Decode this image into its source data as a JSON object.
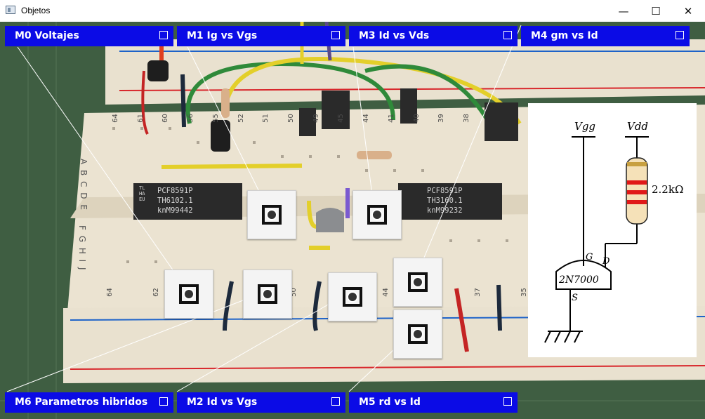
{
  "window": {
    "title": "Objetos",
    "controls": {
      "minimize": "—",
      "maximize": "☐",
      "close": "✕"
    }
  },
  "menus": {
    "top": [
      {
        "id": "M0",
        "label": "M0  Voltajes"
      },
      {
        "id": "M1",
        "label": "M1  Ig vs Vgs"
      },
      {
        "id": "M3",
        "label": "M3  Id vs Vds"
      },
      {
        "id": "M4",
        "label": "M4  gm vs Id"
      }
    ],
    "bottom": [
      {
        "id": "M6",
        "label": "M6  Parametros hibridos"
      },
      {
        "id": "M2",
        "label": "M2  Id vs Vgs"
      },
      {
        "id": "M5",
        "label": "M5  rd vs Id"
      }
    ]
  },
  "breadboard": {
    "row_letters_top": "A B C D E",
    "row_letters_bottom": "F G H I J",
    "column_numbers_top": [
      "64",
      "61",
      "60",
      "56",
      "55",
      "52",
      "51",
      "50",
      "49",
      "45",
      "44",
      "41",
      "40",
      "39",
      "38"
    ],
    "column_numbers_bottom": [
      "64",
      "62",
      "61",
      "56",
      "50",
      "45",
      "44",
      "40",
      "37",
      "35"
    ],
    "chips": [
      {
        "line1": "PCF8591P",
        "line2": "TH6102.1",
        "line3": "knM99442",
        "logo": "TL HA EU"
      },
      {
        "line1": "PCF8591P",
        "line2": "TH3160.1",
        "line3": "knM99232",
        "logo": ""
      }
    ]
  },
  "circuit": {
    "vgg_label": "Vgg",
    "vdd_label": "Vdd",
    "resistor_value": "2.2kΩ",
    "transistor": "2N7000",
    "pin_g": "G",
    "pin_d": "D",
    "pin_s": "S"
  },
  "colors": {
    "menu_bg": "#0b0be6",
    "menu_text": "#ffffff",
    "board_bg": "#e9e1cf",
    "mat_green": "#3f5e42",
    "rail_red": "#d8262b",
    "rail_blue": "#1e63c9"
  }
}
